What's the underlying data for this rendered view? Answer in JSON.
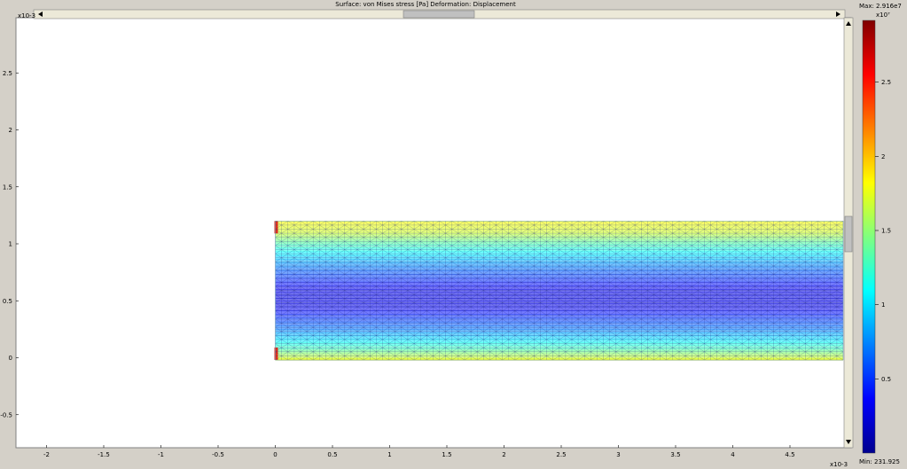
{
  "chart_data": {
    "type": "heatmap",
    "title": "Surface: von Mises stress [Pa]   Deformation: Displacement",
    "x_axis": {
      "range": [
        -2.2,
        5.0
      ],
      "ticks": [
        -2,
        -1.5,
        -1,
        -0.5,
        0,
        0.5,
        1,
        1.5,
        2,
        2.5,
        3,
        3.5,
        4,
        4.5
      ],
      "tick_labels": [
        "-2",
        "-1.5",
        "-1",
        "-0.5",
        "0",
        "0.5",
        "1",
        "1.5",
        "2",
        "2.5",
        "3",
        "3.5",
        "4",
        "4.5"
      ],
      "exponent": "x10-3"
    },
    "y_axis": {
      "range": [
        -0.78,
        2.98
      ],
      "ticks": [
        -0.5,
        0,
        0.5,
        1,
        1.5,
        2,
        2.5
      ],
      "tick_labels": [
        "-0.5",
        "0",
        "0.5",
        "1",
        "1.5",
        "2",
        "2.5"
      ],
      "exponent": "x10-3"
    },
    "domain": {
      "x": [
        0,
        5.0
      ],
      "y": [
        -0.02,
        1.2
      ]
    },
    "colorbar": {
      "max_label": "Max: 2.916e7",
      "min_label": "Min: 231.925",
      "exponent": "x10⁷",
      "ticks": [
        0.5,
        1,
        1.5,
        2,
        2.5
      ],
      "tick_labels": [
        "0.5",
        "1",
        "1.5",
        "2",
        "2.5"
      ],
      "range": [
        0,
        2.916
      ],
      "colormap": "jet"
    },
    "stress_profile": {
      "description_y": [
        -0.02,
        0.0,
        0.08,
        0.25,
        0.45,
        0.6,
        0.8,
        1.0,
        1.1,
        1.2
      ],
      "relative_level": [
        0.62,
        0.58,
        0.45,
        0.25,
        0.1,
        0.1,
        0.25,
        0.45,
        0.58,
        0.62
      ]
    }
  },
  "colors": {
    "background": "#ffffff",
    "frame": "#d4d0c8",
    "mesh_line": "#1a237e"
  }
}
